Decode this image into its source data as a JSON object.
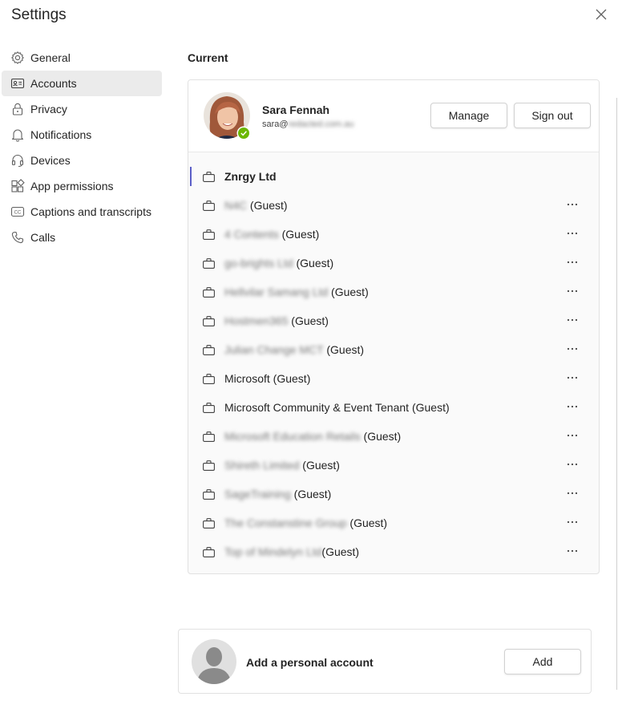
{
  "window": {
    "title": "Settings",
    "close_icon": "close-icon"
  },
  "nav": {
    "items": [
      {
        "label": "General",
        "icon": "gear-icon",
        "active": false
      },
      {
        "label": "Accounts",
        "icon": "account-card-icon",
        "active": true
      },
      {
        "label": "Privacy",
        "icon": "lock-icon",
        "active": false
      },
      {
        "label": "Notifications",
        "icon": "bell-icon",
        "active": false
      },
      {
        "label": "Devices",
        "icon": "headset-icon",
        "active": false
      },
      {
        "label": "App permissions",
        "icon": "apps-icon",
        "active": false
      },
      {
        "label": "Captions and transcripts",
        "icon": "cc-icon",
        "active": false
      },
      {
        "label": "Calls",
        "icon": "phone-icon",
        "active": false
      }
    ]
  },
  "current": {
    "heading": "Current",
    "user": {
      "name": "Sara Fennah",
      "email_prefix": "sara@",
      "email_rest": "redacted.com.au",
      "status": "available"
    },
    "manage_label": "Manage",
    "signout_label": "Sign out",
    "tenants": [
      {
        "name_blurred": "",
        "name": "Znrgy Ltd",
        "suffix": "",
        "selected": true
      },
      {
        "name_blurred": "N4C",
        "name": "",
        "suffix": " (Guest)",
        "selected": false
      },
      {
        "name_blurred": "4 Contents",
        "name": "",
        "suffix": " (Guest)",
        "selected": false
      },
      {
        "name_blurred": "go-brights Ltd",
        "name": "",
        "suffix": " (Guest)",
        "selected": false
      },
      {
        "name_blurred": "Hellvilar Samang Ltd",
        "name": "",
        "suffix": " (Guest)",
        "selected": false
      },
      {
        "name_blurred": "Hostmen365",
        "name": "",
        "suffix": " (Guest)",
        "selected": false
      },
      {
        "name_blurred": "Julian Change MCT",
        "name": "",
        "suffix": " (Guest)",
        "selected": false
      },
      {
        "name_blurred": "",
        "name": "Microsoft",
        "suffix": " (Guest)",
        "selected": false
      },
      {
        "name_blurred": "",
        "name": "Microsoft Community & Event Tenant",
        "suffix": " (Guest)",
        "selected": false
      },
      {
        "name_blurred": "Microsoft Education Retails",
        "name": "",
        "suffix": " (Guest)",
        "selected": false
      },
      {
        "name_blurred": "Shireth Limited",
        "name": "",
        "suffix": " (Guest)",
        "selected": false
      },
      {
        "name_blurred": "SageTraining",
        "name": "",
        "suffix": " (Guest)",
        "selected": false
      },
      {
        "name_blurred": "The Constanstine Group",
        "name": "",
        "suffix": " (Guest)",
        "selected": false
      },
      {
        "name_blurred": "Top of Mindelyn Ltd",
        "name": "",
        "suffix": "(Guest)",
        "selected": false
      }
    ]
  },
  "personal": {
    "label": "Add a personal account",
    "add_label": "Add"
  },
  "colors": {
    "accent": "#5b5fc7",
    "presence": "#6bb700",
    "selected_nav": "#ebebeb"
  }
}
